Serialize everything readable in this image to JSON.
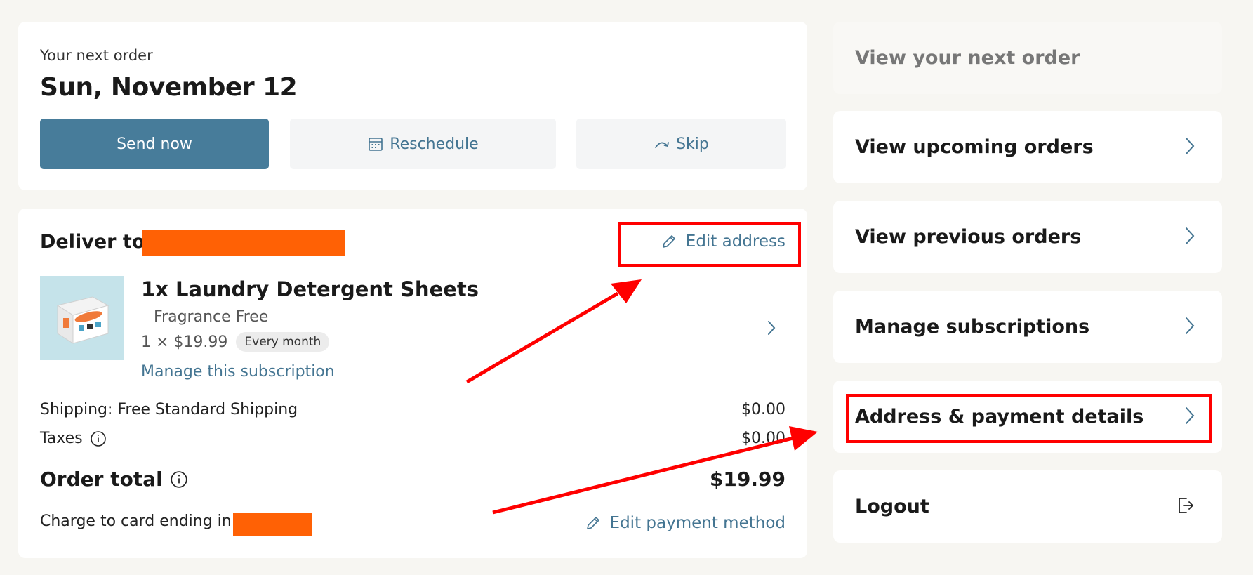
{
  "next_order": {
    "label": "Your next order",
    "date": "Sun, November 12",
    "send_now": "Send now",
    "reschedule": "Reschedule",
    "skip": "Skip"
  },
  "delivery": {
    "title": "Deliver to",
    "edit_address": "Edit address",
    "product": {
      "name": "1x Laundry Detergent Sheets",
      "variant": "Fragrance Free",
      "price": "1 × $19.99",
      "frequency": "Every month",
      "manage_link": "Manage this subscription"
    },
    "shipping_label": "Shipping: Free Standard Shipping",
    "shipping_value": "$0.00",
    "taxes_label": "Taxes",
    "taxes_value": "$0.00",
    "total_label": "Order total",
    "total_value": "$19.99",
    "card_label": "Charge to card ending in",
    "edit_payment": "Edit payment method"
  },
  "menu": {
    "next": "View your next order",
    "upcoming": "View upcoming orders",
    "previous": "View previous orders",
    "manage": "Manage subscriptions",
    "address": "Address & payment details",
    "logout": "Logout"
  },
  "colors": {
    "primary": "#477c9a",
    "link": "#447592",
    "redaction": "#ff6105",
    "annotation": "#ff0000",
    "background": "#f7f6f2"
  }
}
